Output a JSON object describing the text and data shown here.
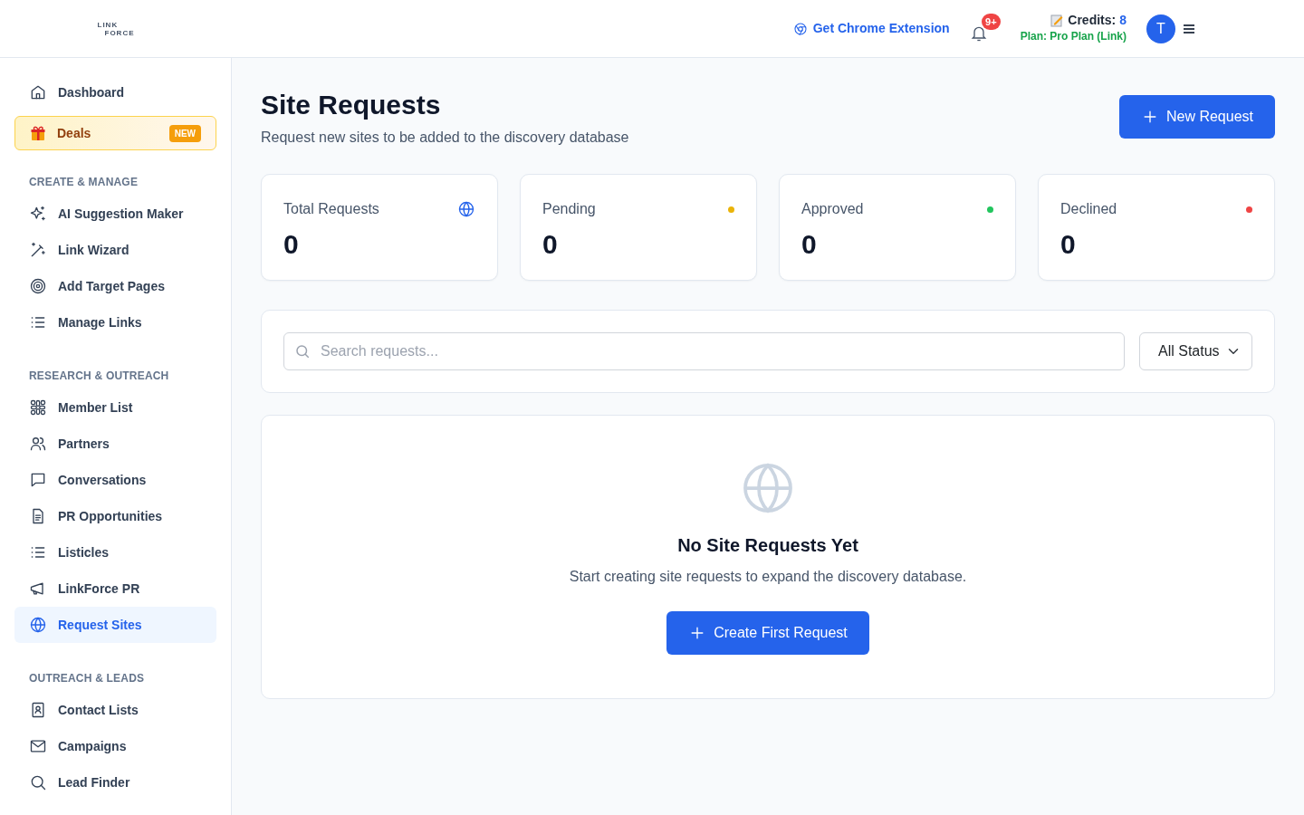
{
  "header": {
    "logo": [
      "LINK",
      "FORCE"
    ],
    "extension_link": "Get Chrome Extension",
    "notifications_badge": "9+",
    "credits_label": "Credits:",
    "credits_value": "8",
    "plan": "Plan: Pro Plan (Link)",
    "avatar": "T"
  },
  "sidebar": {
    "top_items": [
      {
        "label": "Dashboard",
        "kind": "plain",
        "selected": false
      },
      {
        "label": "Deals",
        "kind": "promo",
        "badge": "NEW"
      }
    ],
    "sections": [
      {
        "title": "CREATE & MANAGE",
        "items": [
          {
            "label": "AI Suggestion Maker",
            "selected": false
          },
          {
            "label": "Link Wizard",
            "selected": false
          },
          {
            "label": "Add Target Pages",
            "selected": false
          },
          {
            "label": "Manage Links",
            "selected": false
          }
        ]
      },
      {
        "title": "RESEARCH & OUTREACH",
        "items": [
          {
            "label": "Member List",
            "selected": false
          },
          {
            "label": "Partners",
            "selected": false
          },
          {
            "label": "Conversations",
            "selected": false
          },
          {
            "label": "PR Opportunities",
            "selected": false
          },
          {
            "label": "Listicles",
            "selected": false
          },
          {
            "label": "LinkForce PR",
            "selected": false
          },
          {
            "label": "Request Sites",
            "selected": true
          }
        ]
      },
      {
        "title": "OUTREACH & LEADS",
        "items": [
          {
            "label": "Contact Lists",
            "selected": false
          },
          {
            "label": "Campaigns",
            "selected": false
          },
          {
            "label": "Lead Finder",
            "selected": false
          }
        ]
      }
    ]
  },
  "page": {
    "title": "Site Requests",
    "subtitle": "Request new sites to be added to the discovery database",
    "new_button": "New Request"
  },
  "stats": [
    {
      "label": "Total Requests",
      "value": "0",
      "kind": "icon"
    },
    {
      "label": "Pending",
      "value": "0",
      "kind": "dot",
      "color": "#eab308"
    },
    {
      "label": "Approved",
      "value": "0",
      "kind": "dot",
      "color": "#22c55e"
    },
    {
      "label": "Declined",
      "value": "0",
      "kind": "dot",
      "color": "#ef4444"
    }
  ],
  "filters": {
    "search": {
      "placeholder": "Search requests..."
    },
    "status": "All Status"
  },
  "empty_state": {
    "title": "No Site Requests Yet",
    "text": "Start creating site requests to expand the discovery database.",
    "button": "Create First Request"
  }
}
